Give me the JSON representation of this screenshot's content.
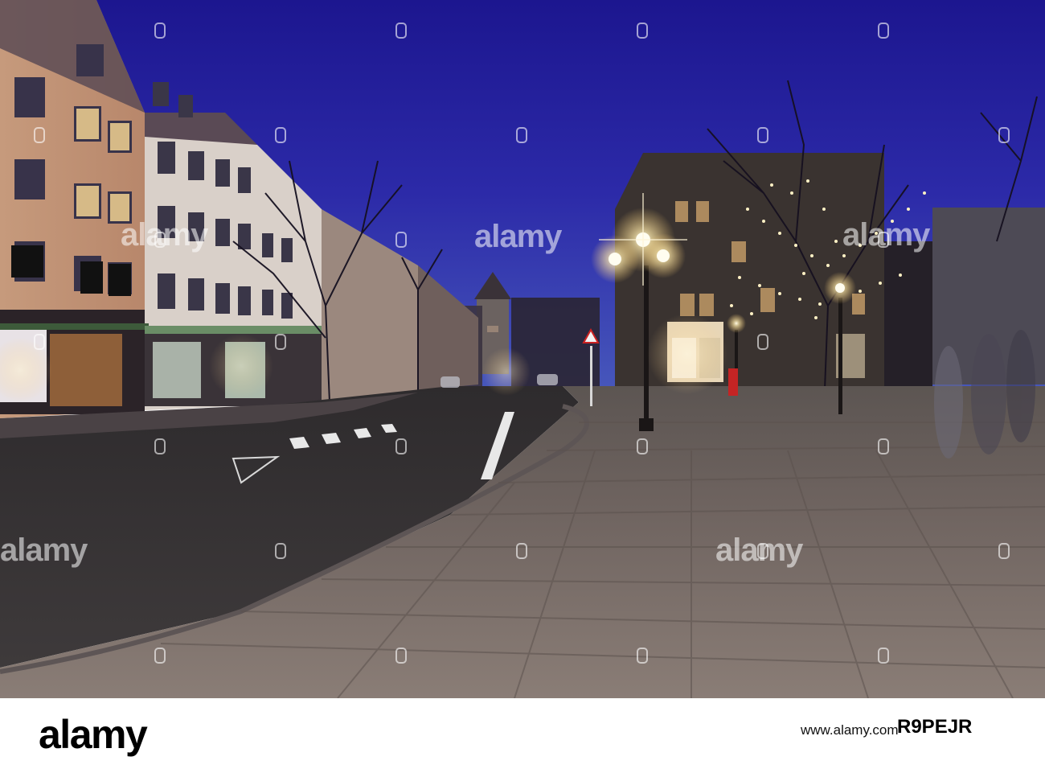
{
  "scene": {
    "description_colors": {
      "sky_top": "#2a1fa0",
      "sky_bottom": "#3d48b8",
      "pavement": "#7a6e66",
      "road": "#3e3a3a",
      "facade_left": "#c9a487",
      "lamp_glow": "#fff2c8"
    }
  },
  "watermark": {
    "text": "alamy"
  },
  "footer": {
    "logo": "alamy",
    "url": "www.alamy.com",
    "image_id": "R9PEJR"
  }
}
